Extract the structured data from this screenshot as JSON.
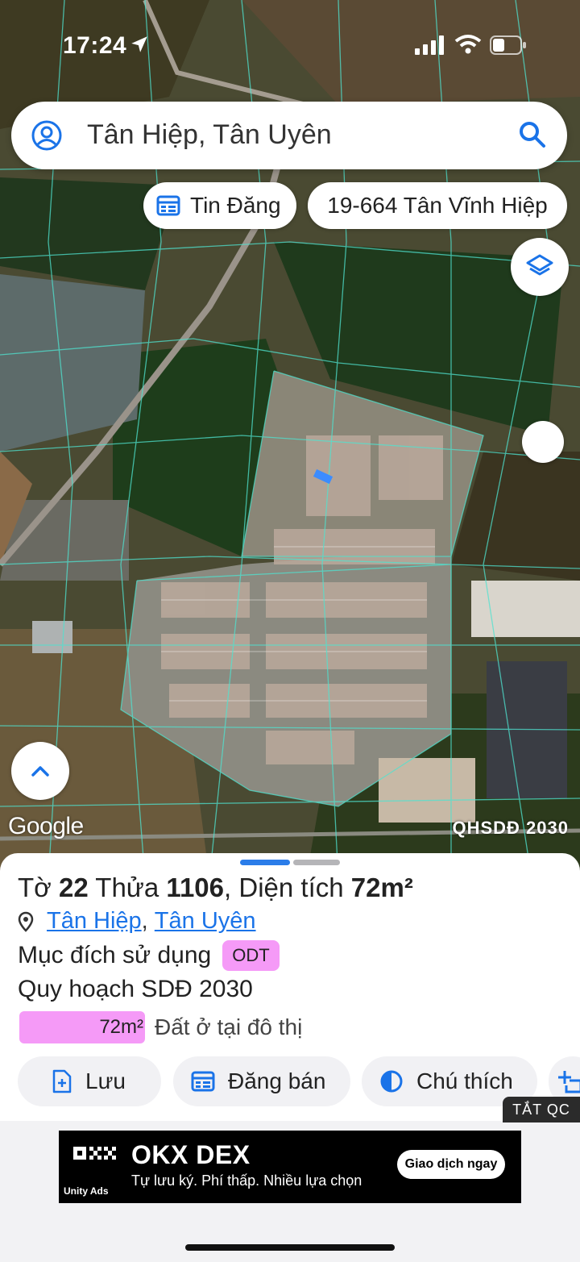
{
  "status_bar": {
    "time": "17:24"
  },
  "search": {
    "query": "Tân Hiệp, Tân Uyên"
  },
  "chips": {
    "listings": "Tin Đăng",
    "parcel_code": "19-664 Tân Vĩnh Hiệp"
  },
  "map": {
    "attribution": "Google",
    "plan_label": "QHSDĐ 2030"
  },
  "parcel": {
    "sheet_label": "Tờ",
    "sheet_number": "22",
    "plot_label": "Thửa",
    "plot_number": "1106",
    "area_label": "Diện tích",
    "area_value": "72m²",
    "ward": "Tân Hiệp",
    "separator": ",",
    "district": "Tân Uyên",
    "purpose_label": "Mục đích sử dụng",
    "purpose_code": "ODT",
    "plan_label": "Quy hoạch SDĐ 2030",
    "plan_area": "72m²",
    "plan_description": "Đất ở tại đô thị"
  },
  "actions": {
    "save": "Lưu",
    "post_sale": "Đăng bán",
    "legend": "Chú thích"
  },
  "ad": {
    "hide_label": "TẮT QC",
    "brand": "OKX DEX",
    "tagline": "Tự lưu ký. Phí thấp. Nhiều lựa chọn",
    "cta": "Giao dịch ngay",
    "network": "Unity Ads"
  },
  "colors": {
    "accent": "#1a73e8",
    "odt_pink": "#f59af7",
    "parcel_line": "#4fe3d0"
  }
}
